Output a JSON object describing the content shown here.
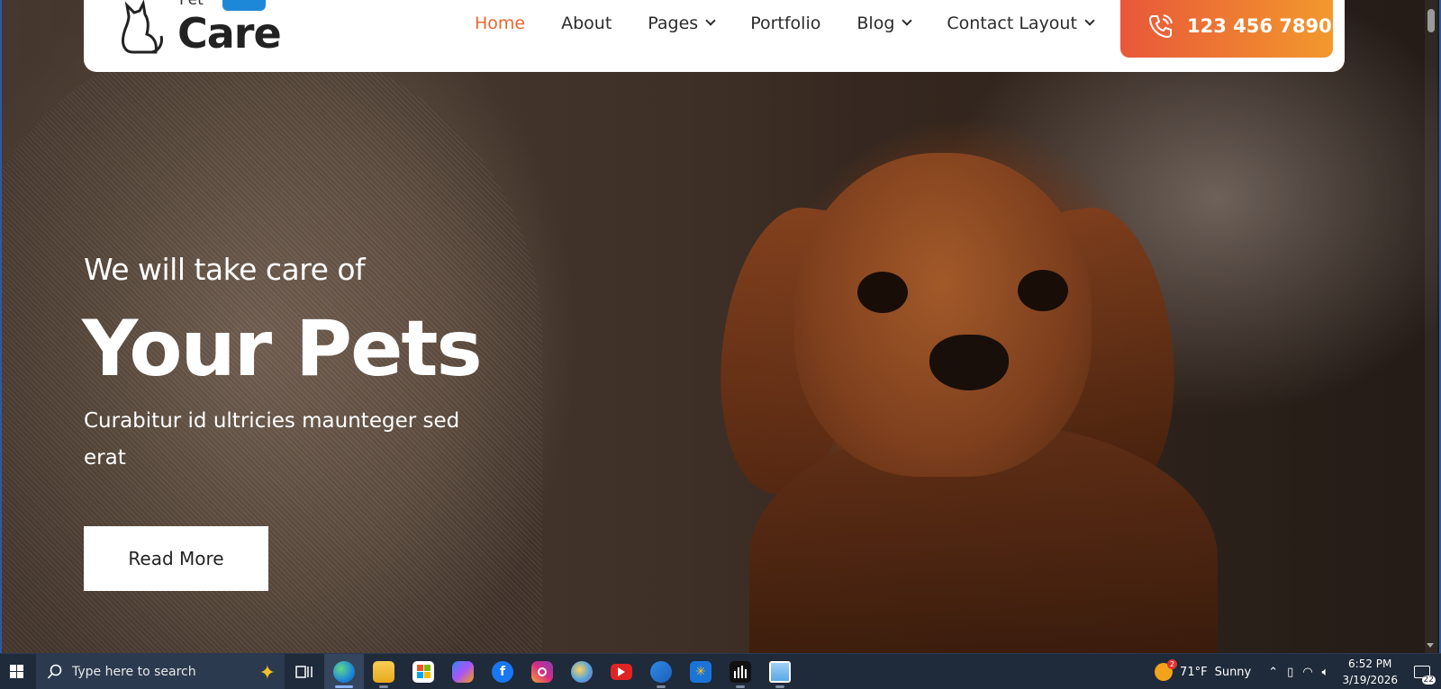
{
  "header": {
    "logo": {
      "small": "Pet",
      "big": "Care"
    },
    "nav": [
      {
        "label": "Home",
        "active": true,
        "dropdown": false
      },
      {
        "label": "About",
        "active": false,
        "dropdown": false
      },
      {
        "label": "Pages",
        "active": false,
        "dropdown": true
      },
      {
        "label": "Portfolio",
        "active": false,
        "dropdown": false
      },
      {
        "label": "Blog",
        "active": false,
        "dropdown": true
      },
      {
        "label": "Contact Layout",
        "active": false,
        "dropdown": true
      }
    ],
    "phone": "123 456 7890"
  },
  "hero": {
    "subtitle": "We will take care of",
    "title": "Your Pets",
    "description": "Curabitur id ultricies maunteger sed erat",
    "cta": "Read More"
  },
  "taskbar": {
    "search_placeholder": "Type here to search",
    "apps": [
      {
        "name": "task-view-icon",
        "color": "#1f2a3a"
      },
      {
        "name": "edge-icon",
        "color": "#1e88d8"
      },
      {
        "name": "file-explorer-icon",
        "color": "#f2b632"
      },
      {
        "name": "store-icon",
        "color": "#3b7de0"
      },
      {
        "name": "copilot-icon",
        "color": "#8a5ce6"
      },
      {
        "name": "facebook-icon",
        "color": "#1877f2"
      },
      {
        "name": "instagram-icon",
        "color": "#d62e84"
      },
      {
        "name": "paint-icon",
        "color": "#4aa0e6"
      },
      {
        "name": "youtube-icon",
        "color": "#e02424"
      },
      {
        "name": "outlook-icon",
        "color": "#1e6fc8"
      },
      {
        "name": "walmart-icon",
        "color": "#1a74d8"
      },
      {
        "name": "audio-icon",
        "color": "#111111"
      },
      {
        "name": "photos-icon",
        "color": "#5aa8e6"
      }
    ],
    "weather": {
      "temp": "71°F",
      "condition": "Sunny",
      "badge": "2"
    },
    "time": "6:52 PM",
    "date": "3/19/2026",
    "notifications": "22"
  },
  "colors": {
    "accent": "#e8682d",
    "phone_gradient_start": "#e8573a",
    "phone_gradient_end": "#f2992c"
  }
}
